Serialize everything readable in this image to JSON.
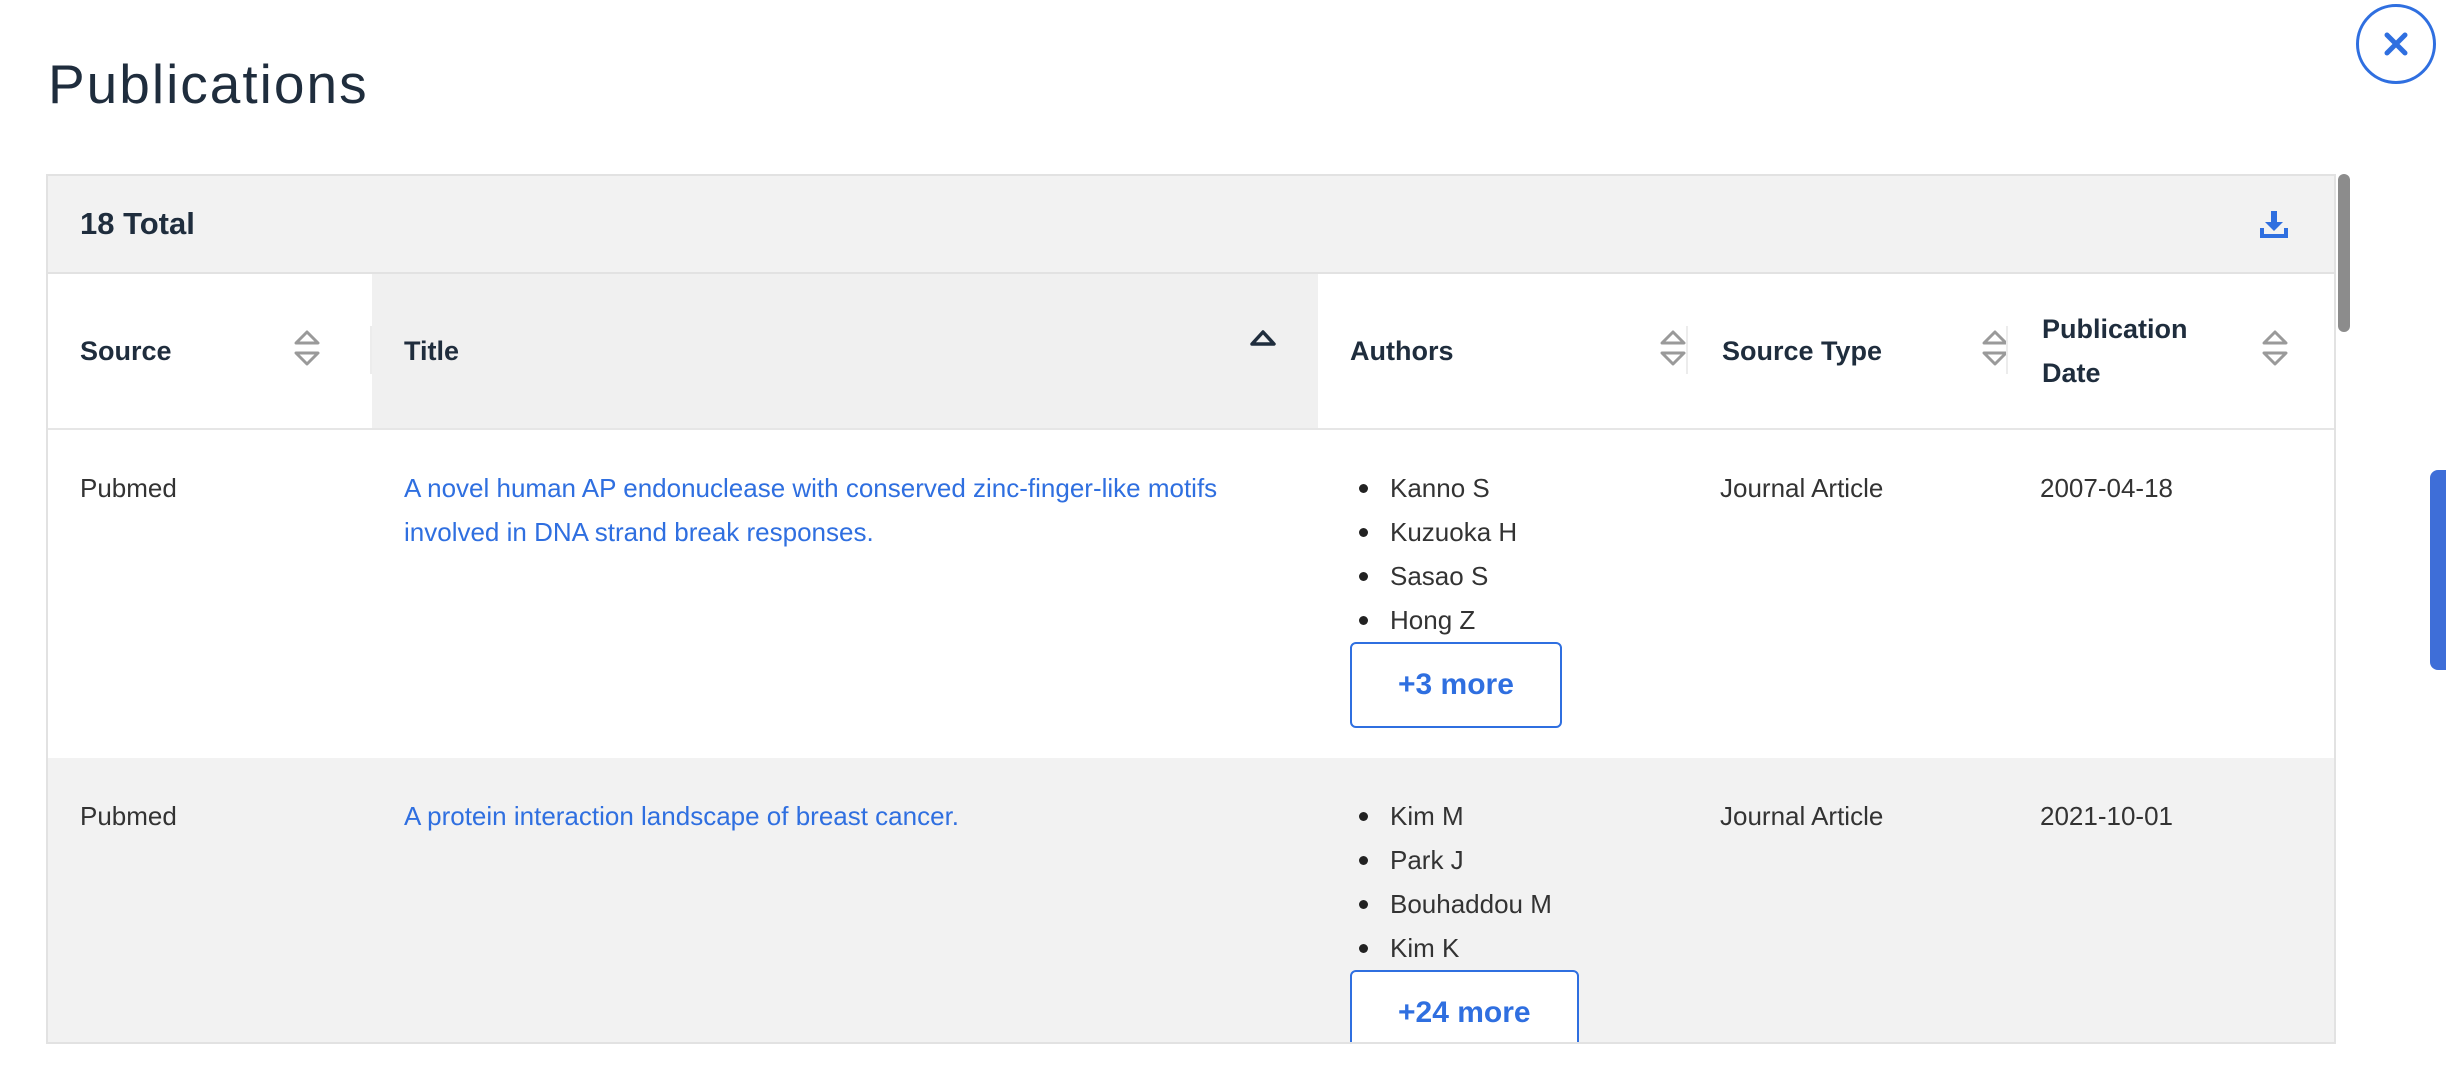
{
  "page": {
    "title": "Publications"
  },
  "table": {
    "total_label": "18 Total",
    "columns": [
      {
        "key": "source",
        "label": "Source"
      },
      {
        "key": "title",
        "label": "Title"
      },
      {
        "key": "authors",
        "label": "Authors"
      },
      {
        "key": "source_type",
        "label": "Source Type"
      },
      {
        "key": "publication_date",
        "label": "Publication Date",
        "label_line1": "Publication",
        "label_line2": "Date"
      }
    ],
    "sorted_column": "title",
    "sort_direction": "ascending",
    "rows": [
      {
        "source": "Pubmed",
        "title_line1": "A novel human AP endonuclease with conserved zinc-finger-like motifs",
        "title_line2": "involved in DNA strand break responses.",
        "authors": [
          "Kanno S",
          "Kuzuoka H",
          "Sasao S",
          "Hong Z"
        ],
        "more_label": "+3 more",
        "source_type": "Journal Article",
        "publication_date": "2007-04-18"
      },
      {
        "source": "Pubmed",
        "title_line1": "A protein interaction landscape of breast cancer.",
        "authors": [
          "Kim M",
          "Park J",
          "Bouhaddou M",
          "Kim K"
        ],
        "more_label": "+24 more",
        "source_type": "Journal Article",
        "publication_date": "2021-10-01"
      }
    ]
  },
  "icons": {
    "close": "close-icon",
    "download": "download-icon",
    "sort": "sort-icon",
    "sort_ascending": "sort-ascending-icon"
  },
  "colors": {
    "accent": "#2f6fe0",
    "header_bg": "#f2f2f2",
    "alt_row_bg": "#f2f2f2",
    "text": "#1f2d3d"
  }
}
